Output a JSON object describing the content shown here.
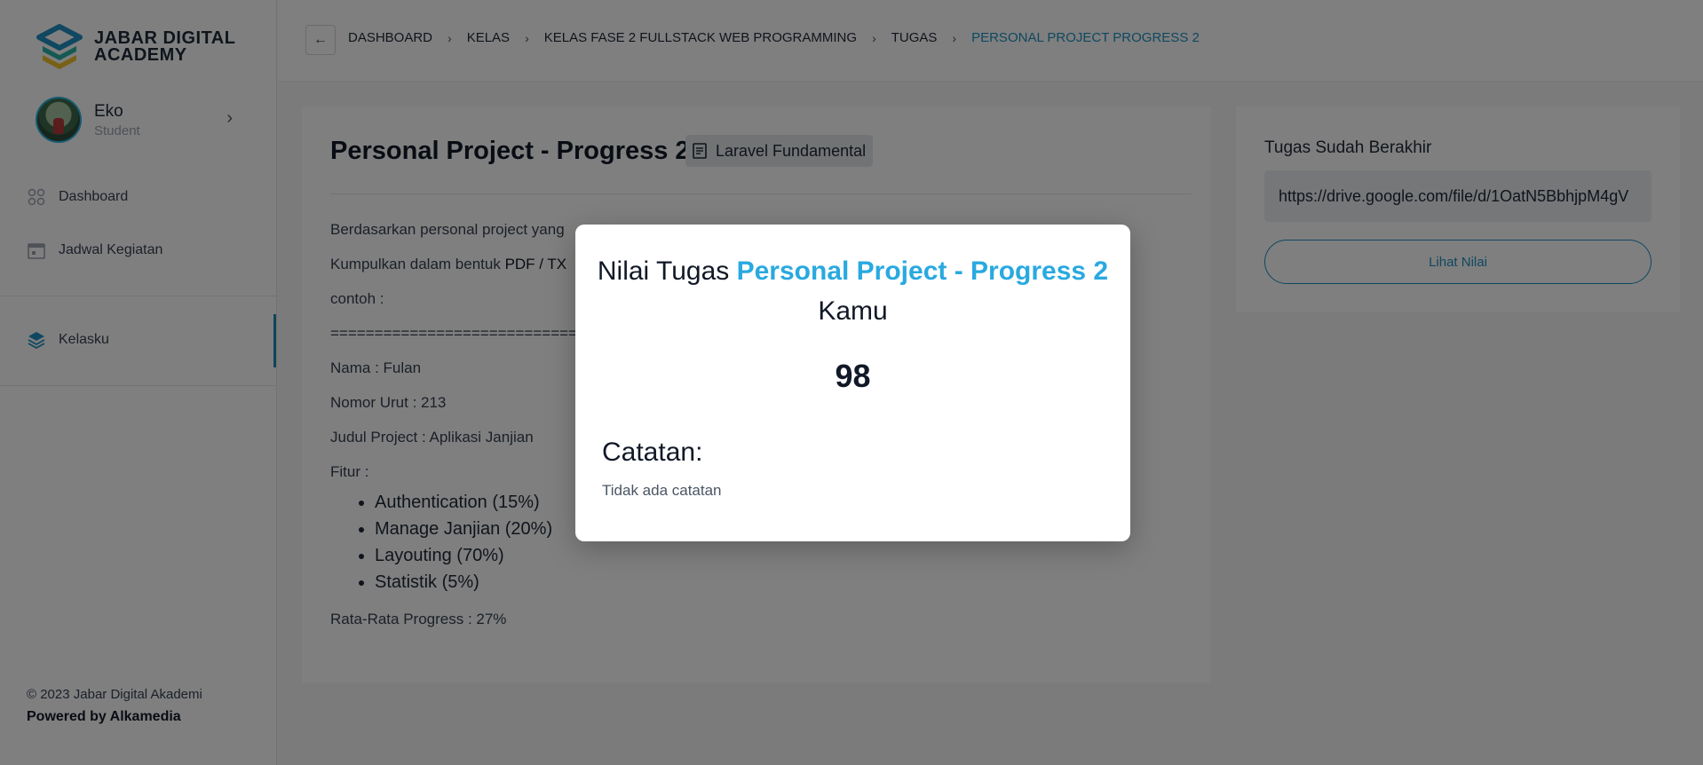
{
  "brand": {
    "name": "JABAR DIGITAL ACADEMY"
  },
  "profile": {
    "name": "Eko",
    "role": "Student"
  },
  "nav": [
    {
      "label": "Dashboard",
      "icon": "grid-icon"
    },
    {
      "label": "Jadwal Kegiatan",
      "icon": "calendar-icon"
    },
    {
      "label": "Kelasku",
      "icon": "layers-icon",
      "active": true
    }
  ],
  "footer": {
    "copyright": "© 2023 Jabar Digital Akademi",
    "powered": "Powered by Alkamedia"
  },
  "breadcrumb": [
    "DASHBOARD",
    "KELAS",
    "KELAS FASE 2 FULLSTACK WEB PROGRAMMING",
    "TUGAS",
    "PERSONAL PROJECT PROGRESS 2"
  ],
  "assignment": {
    "title": "Personal Project - Progress 2",
    "tag": "Laravel Fundamental",
    "desc_line1": "Berdasarkan personal project yang",
    "desc_line2_prefix": "Kumpulkan dalam bentuk ",
    "desc_line2_strong": "PDF / TX",
    "desc_line3": "contoh :",
    "separator": "================================",
    "nama": "Nama : Fulan",
    "nomor": "Nomor Urut : 213",
    "judul": "Judul Project : Aplikasi Janjian",
    "fitur_label": "Fitur :",
    "features": [
      "Authentication (15%)",
      "Manage Janjian (20%)",
      "Layouting (70%)",
      "Statistik (5%)"
    ],
    "average": "Rata-Rata Progress : 27%"
  },
  "submission": {
    "status": "Tugas Sudah Berakhir",
    "link": "https://drive.google.com/file/d/1OatN5BbhjpM4gV",
    "view_button": "Lihat Nilai"
  },
  "modal": {
    "heading_prefix": "Nilai Tugas ",
    "heading_accent": "Personal Project - Progress 2",
    "heading_suffix": " Kamu",
    "score": "98",
    "notes_title": "Catatan:",
    "notes": "Tidak ada catatan"
  },
  "colors": {
    "accent": "#29a9e0",
    "primary": "#1e90c0",
    "overlay": "rgba(0,0,0,0.5)"
  }
}
